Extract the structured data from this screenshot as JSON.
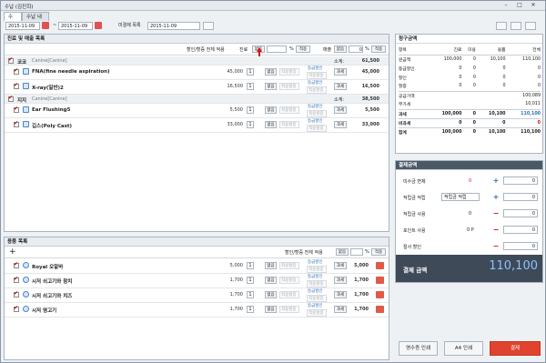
{
  "window": {
    "title": "수납 (김진희)",
    "min": "–",
    "max": "□",
    "close": "✕"
  },
  "tabs": [
    "수납",
    "수납 내역"
  ],
  "toolbar": {
    "date_from": "2015-11-09",
    "sep": "~",
    "date_to": "2015-11-09",
    "unsettled_label": "미결제 목록",
    "unsettled_date": "2015-11-09"
  },
  "treatment": {
    "title": "진료 및 매출 목록",
    "bulk_label": "할인/할증 전체 적용",
    "bulk_prefix": "진료",
    "bulk_btn": "없음",
    "pct": "%",
    "apply": "적용",
    "sales_label": "매출",
    "sales_btn": "없음",
    "sales_value": "0",
    "groups": [
      {
        "name": "코코",
        "sub": "Canine[Canine]",
        "subtotal_label": "소계:",
        "subtotal": "61,500",
        "items": [
          {
            "name": "FNA(fine needle aspiration)",
            "price": "45,000",
            "qty": "1",
            "disc": "없음",
            "total": "45,000"
          },
          {
            "name": "X-ray(일반)2",
            "price": "16,500",
            "qty": "1",
            "disc": "없음",
            "total": "16,500"
          }
        ]
      },
      {
        "name": "지지",
        "sub": "Canine[Canine]",
        "subtotal_label": "소계:",
        "subtotal": "38,500",
        "items": [
          {
            "name": "Ear Flushing5",
            "price": "5,500",
            "qty": "1",
            "disc": "없음",
            "total": "5,500"
          },
          {
            "name": "깁스(Poly Cast)",
            "price": "33,000",
            "qty": "1",
            "disc": "없음",
            "total": "33,000"
          }
        ]
      }
    ],
    "tax_btn": "과세",
    "grade_link": "등급할인",
    "placeholder_pct": "적용할증"
  },
  "goods": {
    "title": "용품 목록",
    "add": "+",
    "bulk_label": "할인/할증 전체 적용",
    "bulk_btn": "없음",
    "pct": "%",
    "apply": "적용",
    "items": [
      {
        "name": "Royal 오알바",
        "price": "5,000",
        "qty": "1",
        "disc": "없음",
        "total": "5,000"
      },
      {
        "name": "시저 쇠고기와 참치",
        "price": "1,700",
        "qty": "1",
        "disc": "없음",
        "total": "1,700"
      },
      {
        "name": "시저 쇠고기와 치즈",
        "price": "1,700",
        "qty": "1",
        "disc": "없음",
        "total": "1,700"
      },
      {
        "name": "시저 영고기",
        "price": "1,700",
        "qty": "1",
        "disc": "없음",
        "total": "1,700"
      }
    ]
  },
  "billing": {
    "title": "청구금액",
    "headers": [
      "항목",
      "진료",
      "미용",
      "용품",
      "전체"
    ],
    "rows": [
      {
        "k": "원금액",
        "v": [
          "100,000",
          "0",
          "10,100",
          "110,100"
        ]
      },
      {
        "k": "등급할인",
        "v": [
          "0",
          "0",
          "0",
          "0"
        ]
      },
      {
        "k": "할인",
        "v": [
          "0",
          "0",
          "0",
          "0"
        ]
      },
      {
        "k": "할증",
        "v": [
          "0",
          "0",
          "0",
          "0"
        ]
      }
    ],
    "supply_label": "공급가액",
    "supply": "100,089",
    "vat_label": "부가세",
    "vat": "10,011",
    "tax_row": {
      "k": "과세",
      "v": [
        "100,000",
        "0",
        "10,100",
        "110,100"
      ]
    },
    "nontax_row": {
      "k": "비과세",
      "v": [
        "0",
        "0",
        "0",
        "0"
      ]
    },
    "sum_row": {
      "k": "합계",
      "v": [
        "100,000",
        "0",
        "10,100",
        "110,100"
      ]
    }
  },
  "payment": {
    "title": "결제금액",
    "rows": [
      {
        "label": "미수금 변제",
        "value": "0",
        "input": "0",
        "op": "+"
      },
      {
        "label": "적립금 적립",
        "sel": "적립금 적립",
        "op": "+",
        "input": "0"
      },
      {
        "label": "적립금 사용",
        "value": "0",
        "op": "−",
        "input": "0"
      },
      {
        "label": "포인트 사용",
        "value": "0 P",
        "op": "−",
        "input": "0"
      },
      {
        "label": "절사 할인",
        "op": "−",
        "input": "0"
      }
    ],
    "total_label": "결제 금액",
    "total": "110,100"
  },
  "actions": {
    "receipt": "영수증 인쇄",
    "a4": "A4 인쇄",
    "pay": "결제"
  },
  "colors": {
    "accent": "#2e6fb7",
    "danger": "#e05a45",
    "pay_button": "#e0442e"
  }
}
